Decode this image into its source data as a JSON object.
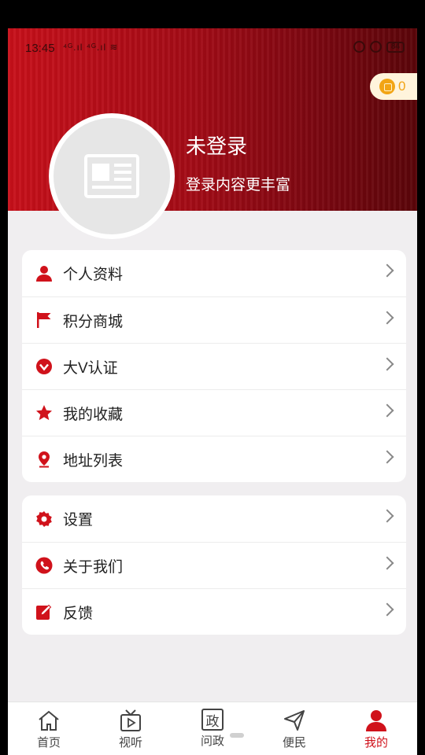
{
  "status_bar": {
    "time": "13:45",
    "signal": "⁴ᴳ.ıl ⁴ᴳ.ıl ≋",
    "battery": "84"
  },
  "coins": {
    "count": "0"
  },
  "profile": {
    "name": "未登录",
    "subtitle": "登录内容更丰富",
    "avatar_icon": "newspaper-placeholder-icon"
  },
  "menu_group_1": [
    {
      "label": "个人资料",
      "icon": "person-icon"
    },
    {
      "label": "积分商城",
      "icon": "flag-icon"
    },
    {
      "label": "大V认证",
      "icon": "verified-icon"
    },
    {
      "label": "我的收藏",
      "icon": "star-icon"
    },
    {
      "label": "地址列表",
      "icon": "location-pin-icon"
    }
  ],
  "menu_group_2": [
    {
      "label": "设置",
      "icon": "gear-icon"
    },
    {
      "label": "关于我们",
      "icon": "phone-icon"
    },
    {
      "label": "反馈",
      "icon": "edit-icon"
    }
  ],
  "tabs": [
    {
      "label": "首页",
      "icon": "home-icon",
      "active": false
    },
    {
      "label": "视听",
      "icon": "tv-icon",
      "active": false
    },
    {
      "label": "问政",
      "icon": "zheng-icon",
      "icon_text": "政",
      "active": false
    },
    {
      "label": "便民",
      "icon": "send-icon",
      "active": false
    },
    {
      "label": "我的",
      "icon": "profile-icon",
      "active": true
    }
  ],
  "colors": {
    "accent": "#d0121b",
    "header_dark": "#5a0509",
    "coin": "#f2a414"
  }
}
